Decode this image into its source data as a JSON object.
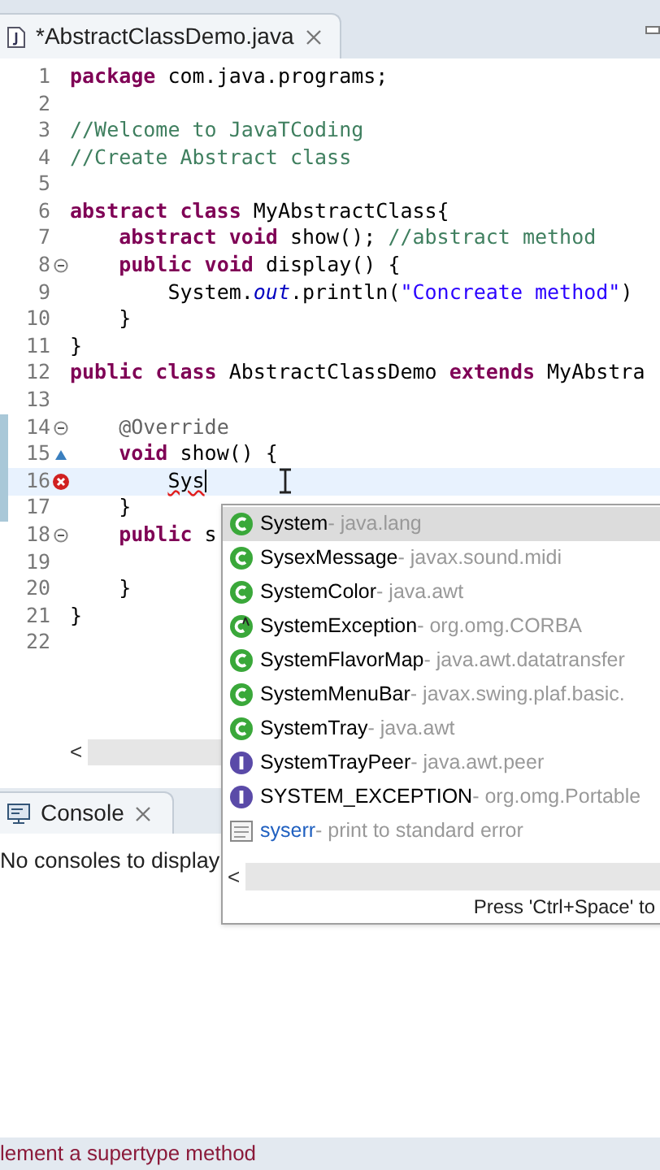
{
  "editor_tab": {
    "title": "*AbstractClassDemo.java",
    "dirty": true
  },
  "code_lines": [
    {
      "number": "1",
      "changed": false,
      "current": false,
      "tokens": [
        {
          "kind": "keyword",
          "text": "package"
        },
        {
          "kind": "plain",
          "text": " com.java.programs;"
        }
      ]
    },
    {
      "number": "2",
      "changed": false,
      "current": false
    },
    {
      "number": "3",
      "changed": false,
      "current": false,
      "tokens": [
        {
          "kind": "comment",
          "text": "//Welcome to JavaTCoding"
        }
      ]
    },
    {
      "number": "4",
      "changed": false,
      "current": false,
      "tokens": [
        {
          "kind": "comment",
          "text": "//Create Abstract class"
        }
      ]
    },
    {
      "number": "5",
      "changed": false,
      "current": false
    },
    {
      "number": "6",
      "changed": false,
      "current": false,
      "tokens": [
        {
          "kind": "keyword",
          "text": "abstract class"
        },
        {
          "kind": "plain",
          "text": " MyAbstractClass{"
        }
      ]
    },
    {
      "number": "7",
      "changed": false,
      "current": false,
      "tokens": [
        {
          "kind": "keyword",
          "text": "    abstract void"
        },
        {
          "kind": "plain",
          "text": " show(); "
        },
        {
          "kind": "comment",
          "text": "//abstract method"
        }
      ]
    },
    {
      "number": "8",
      "gutter_icon": {
        "kind": "fold"
      },
      "changed": false,
      "current": false,
      "tokens": [
        {
          "kind": "keyword",
          "text": "    public void"
        },
        {
          "kind": "plain",
          "text": " display() {"
        }
      ]
    },
    {
      "number": "9",
      "changed": false,
      "current": false,
      "tokens": [
        {
          "kind": "plain",
          "text": "        System."
        },
        {
          "kind": "field",
          "text": "out"
        },
        {
          "kind": "plain",
          "text": ".println("
        },
        {
          "kind": "string",
          "text": "\"Concreate method\""
        },
        {
          "kind": "plain",
          "text": ")"
        }
      ]
    },
    {
      "number": "10",
      "changed": false,
      "current": false,
      "tokens": [
        {
          "kind": "plain",
          "text": "    }"
        }
      ]
    },
    {
      "number": "11",
      "changed": false,
      "current": false,
      "tokens": [
        {
          "kind": "plain",
          "text": "}"
        }
      ]
    },
    {
      "number": "12",
      "changed": false,
      "current": false,
      "tokens": [
        {
          "kind": "keyword",
          "text": "public class"
        },
        {
          "kind": "plain",
          "text": " AbstractClassDemo "
        },
        {
          "kind": "keyword",
          "text": "extends"
        },
        {
          "kind": "plain",
          "text": " MyAbstra"
        }
      ]
    },
    {
      "number": "13",
      "changed": false,
      "current": false
    },
    {
      "number": "14",
      "gutter_icon": {
        "kind": "fold"
      },
      "changed": true,
      "current": false,
      "tokens": [
        {
          "kind": "annotation",
          "text": "    @Override"
        }
      ]
    },
    {
      "number": "15",
      "gutter_icon": {
        "kind": "override"
      },
      "changed": true,
      "current": false,
      "tokens": [
        {
          "kind": "keyword",
          "text": "    void"
        },
        {
          "kind": "plain",
          "text": " show() {"
        }
      ]
    },
    {
      "number": "16",
      "gutter_icon": {
        "kind": "error"
      },
      "changed": true,
      "current": true,
      "tokens": [
        {
          "kind": "error",
          "text": "        Sys"
        }
      ]
    },
    {
      "number": "17",
      "changed": true,
      "current": false,
      "tokens": [
        {
          "kind": "plain",
          "text": "    }"
        }
      ]
    },
    {
      "number": "18",
      "gutter_icon": {
        "kind": "fold"
      },
      "changed": false,
      "current": false,
      "tokens": [
        {
          "kind": "keyword",
          "text": "    public"
        },
        {
          "kind": "plain",
          "text": " s"
        }
      ]
    },
    {
      "number": "19",
      "changed": false,
      "current": false
    },
    {
      "number": "20",
      "changed": false,
      "current": false,
      "tokens": [
        {
          "kind": "plain",
          "text": "    }"
        }
      ]
    },
    {
      "number": "21",
      "changed": false,
      "current": false,
      "tokens": [
        {
          "kind": "plain",
          "text": "}"
        }
      ]
    },
    {
      "number": "22",
      "changed": false,
      "current": false
    }
  ],
  "editor_scrollbar": {
    "arrow": "<"
  },
  "completion_popup": {
    "items": [
      {
        "kind": "class",
        "name": "System",
        "detail": " - java.lang",
        "selected": true
      },
      {
        "kind": "class",
        "name": "SysexMessage",
        "detail": " - javax.sound.midi",
        "selected": false
      },
      {
        "kind": "class",
        "name": "SystemColor",
        "detail": " - java.awt",
        "selected": false
      },
      {
        "kind": "abstract_class",
        "name": "SystemException",
        "detail": " - org.omg.CORBA",
        "selected": false
      },
      {
        "kind": "class",
        "name": "SystemFlavorMap",
        "detail": " - java.awt.datatransfer",
        "selected": false
      },
      {
        "kind": "class",
        "name": "SystemMenuBar",
        "detail": " - javax.swing.plaf.basic.",
        "selected": false
      },
      {
        "kind": "class",
        "name": "SystemTray",
        "detail": " - java.awt",
        "selected": false
      },
      {
        "kind": "interface",
        "name": "SystemTrayPeer",
        "detail": " - java.awt.peer",
        "selected": false
      },
      {
        "kind": "interface",
        "name": "SYSTEM_EXCEPTION",
        "detail": " - org.omg.Portable",
        "selected": false
      },
      {
        "kind": "template",
        "name": "syserr",
        "detail": " - print to standard error",
        "selected": false
      }
    ],
    "scroll_arrow": "<",
    "footer": "Press 'Ctrl+Space' to"
  },
  "console": {
    "tab": "Console",
    "message": "No consoles to display"
  },
  "status_bar": {
    "message": "lement a supertype method"
  }
}
